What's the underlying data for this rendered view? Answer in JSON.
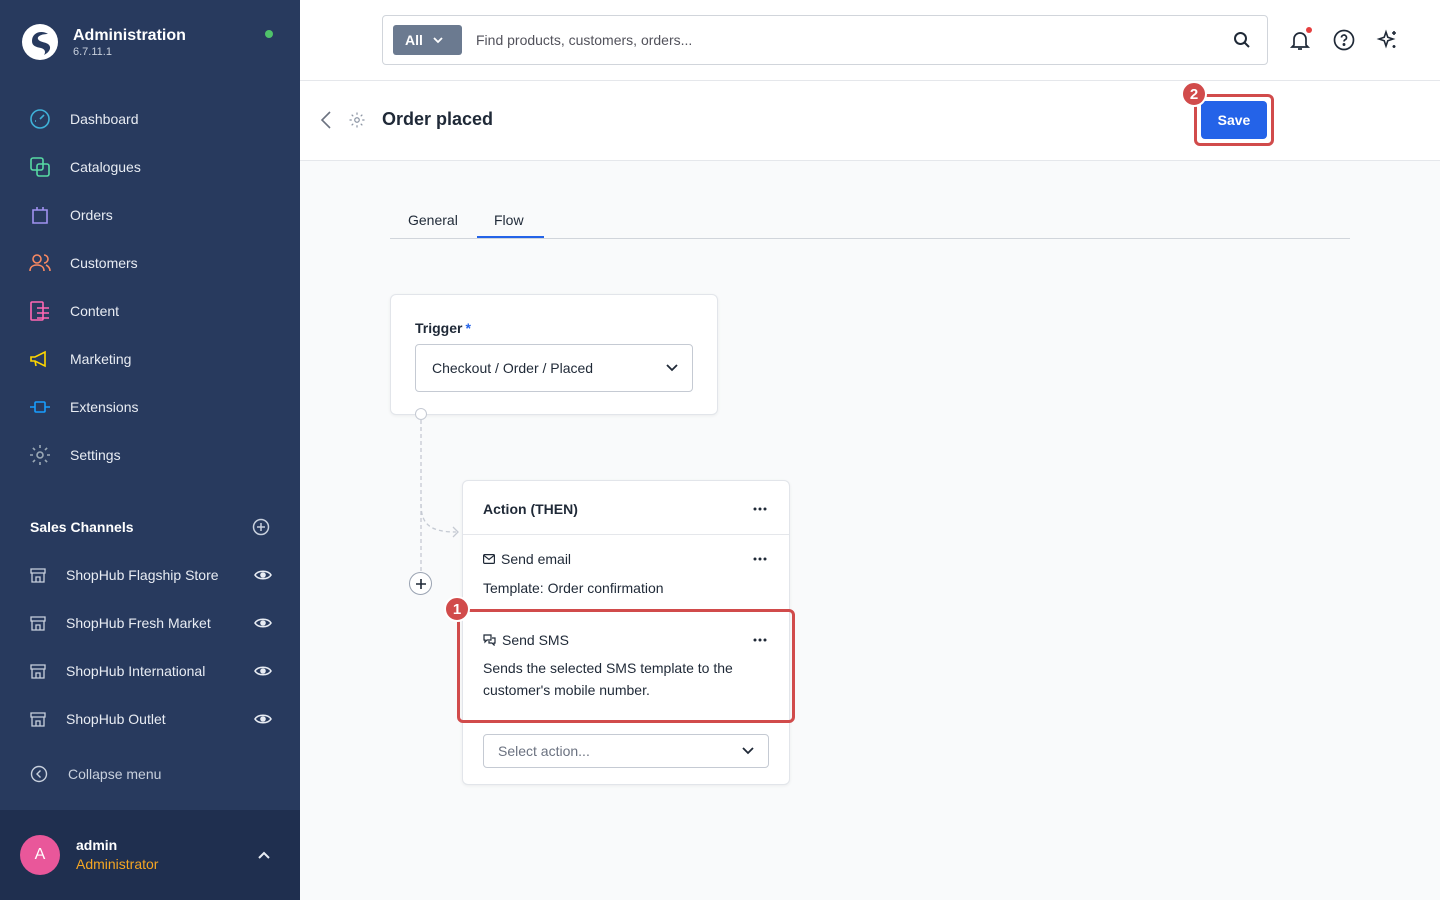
{
  "app": {
    "title": "Administration",
    "version": "6.7.11.1"
  },
  "nav": {
    "items": [
      {
        "label": "Dashboard",
        "icon": "dashboard-icon",
        "color": "#3fb1d8"
      },
      {
        "label": "Catalogues",
        "icon": "catalogues-icon",
        "color": "#57d9a3"
      },
      {
        "label": "Orders",
        "icon": "orders-icon",
        "color": "#a092f0"
      },
      {
        "label": "Customers",
        "icon": "customers-icon",
        "color": "#f88962"
      },
      {
        "label": "Content",
        "icon": "content-icon",
        "color": "#ff68b4"
      },
      {
        "label": "Marketing",
        "icon": "marketing-icon",
        "color": "#ffd700"
      },
      {
        "label": "Extensions",
        "icon": "extensions-icon",
        "color": "#189eff"
      },
      {
        "label": "Settings",
        "icon": "settings-icon",
        "color": "#9aa8b5"
      }
    ]
  },
  "sales_channels": {
    "title": "Sales Channels",
    "items": [
      {
        "label": "ShopHub Flagship Store"
      },
      {
        "label": "ShopHub Fresh Market"
      },
      {
        "label": "ShopHub International"
      },
      {
        "label": "ShopHub Outlet"
      }
    ]
  },
  "collapse_label": "Collapse menu",
  "user": {
    "initial": "A",
    "name": "admin",
    "role": "Administrator"
  },
  "search": {
    "filter_label": "All",
    "placeholder": "Find products, customers, orders..."
  },
  "page": {
    "title": "Order placed",
    "save_label": "Save"
  },
  "badges": {
    "save": "2",
    "sms": "1"
  },
  "tabs": [
    {
      "label": "General",
      "active": false
    },
    {
      "label": "Flow",
      "active": true
    }
  ],
  "trigger": {
    "label": "Trigger",
    "required_mark": "*",
    "value": "Checkout / Order / Placed"
  },
  "action": {
    "title": "Action (THEN)",
    "sequences": [
      {
        "title": "Send email",
        "icon": "mail-icon",
        "body": "Template: Order confirmation"
      },
      {
        "title": "Send SMS",
        "icon": "chat-icon",
        "body": "Sends the selected SMS template to the customer's mobile number."
      }
    ],
    "select_placeholder": "Select action..."
  },
  "colors": {
    "sidebar_bg": "#283a5e",
    "accent": "#2463e8",
    "highlight": "#d14b4b",
    "online_status": "#4fc26a",
    "role_text": "#f5a623",
    "avatar_bg": "#e9579a"
  }
}
